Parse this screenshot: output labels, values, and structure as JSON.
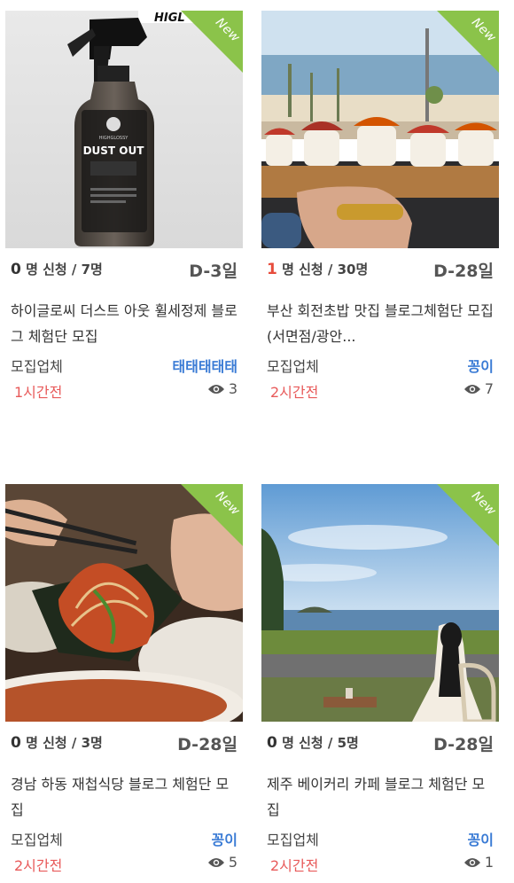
{
  "new_label": "New",
  "colors": {
    "ribbon": "#8bc34a",
    "accent_red": "#e74c3c",
    "company_blue": "#3a7bd5"
  },
  "cards": [
    {
      "applied": "0",
      "applied_suffix": " 명 신청 / 7명",
      "dday": "D-3일",
      "title": "하이글로씨 더스트 아웃 휠세정제 블로그 체험단 모집",
      "label": "모집업체",
      "company": "태태태태태",
      "time": "1시간전",
      "views": "3",
      "product_text": {
        "top_brand": "HIGL",
        "small": "HIGHGLOSSY",
        "name": "DUST OUT"
      }
    },
    {
      "applied": "1",
      "applied_suffix": " 명 신청 / 30명",
      "dday": "D-28일",
      "title": "부산 회전초밥 맛집 블로그체험단 모집 (서면점/광안...",
      "label": "모집업체",
      "company": "꽁이",
      "time": "2시간전",
      "views": "7"
    },
    {
      "applied": "0",
      "applied_suffix": " 명 신청 / 3명",
      "dday": "D-28일",
      "title": "경남 하동 재첩식당 블로그 체험단 모집",
      "label": "모집업체",
      "company": "꽁이",
      "time": "2시간전",
      "views": "5"
    },
    {
      "applied": "0",
      "applied_suffix": " 명 신청 / 5명",
      "dday": "D-28일",
      "title": "제주 베이커리 카페 블로그 체험단 모집",
      "label": "모집업체",
      "company": "꽁이",
      "time": "2시간전",
      "views": "1"
    }
  ]
}
